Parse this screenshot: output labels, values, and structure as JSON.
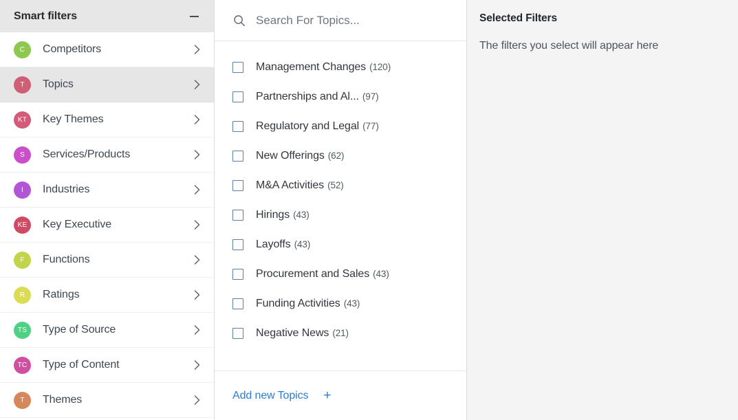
{
  "sidebar": {
    "title": "Smart filters",
    "collapse_icon": "minus-icon",
    "items": [
      {
        "label": "Competitors",
        "initials": "C",
        "color": "#8dc84f",
        "chevron": "chevron-right-icon",
        "active": false
      },
      {
        "label": "Topics",
        "initials": "T",
        "color": "#ce5f74",
        "chevron": "chevron-right-icon",
        "active": true
      },
      {
        "label": "Key Themes",
        "initials": "KT",
        "color": "#d35a78",
        "chevron": "chevron-right-icon",
        "active": false
      },
      {
        "label": "Services/Products",
        "initials": "S",
        "color": "#cb4fcb",
        "chevron": "chevron-right-icon",
        "active": false
      },
      {
        "label": "Industries",
        "initials": "I",
        "color": "#b255d6",
        "chevron": "chevron-right-icon",
        "active": false
      },
      {
        "label": "Key Executive",
        "initials": "KE",
        "color": "#cf4b63",
        "chevron": "chevron-right-icon",
        "active": false
      },
      {
        "label": "Functions",
        "initials": "F",
        "color": "#c2d44a",
        "chevron": "chevron-right-icon",
        "active": false
      },
      {
        "label": "Ratings",
        "initials": "R",
        "color": "#dbdb55",
        "chevron": "chevron-right-icon",
        "active": false
      },
      {
        "label": "Type of Source",
        "initials": "TS",
        "color": "#4ed183",
        "chevron": "chevron-right-icon",
        "active": false
      },
      {
        "label": "Type of Content",
        "initials": "TC",
        "color": "#d14fa0",
        "chevron": "chevron-right-icon",
        "active": false
      },
      {
        "label": "Themes",
        "initials": "T",
        "color": "#d6885c",
        "chevron": "chevron-right-icon",
        "active": false
      }
    ]
  },
  "middle": {
    "search": {
      "icon": "search-icon",
      "placeholder": "Search For Topics...",
      "value": ""
    },
    "topics": [
      {
        "label": "Management Changes",
        "count": "(120)",
        "checked": false
      },
      {
        "label": "Partnerships and Al...",
        "count": "(97)",
        "checked": false
      },
      {
        "label": "Regulatory and Legal",
        "count": "(77)",
        "checked": false
      },
      {
        "label": "New Offerings",
        "count": "(62)",
        "checked": false
      },
      {
        "label": "M&A Activities",
        "count": "(52)",
        "checked": false
      },
      {
        "label": "Hirings",
        "count": "(43)",
        "checked": false
      },
      {
        "label": "Layoffs",
        "count": "(43)",
        "checked": false
      },
      {
        "label": "Procurement and Sales",
        "count": "(43)",
        "checked": false
      },
      {
        "label": "Funding Activities",
        "count": "(43)",
        "checked": false
      },
      {
        "label": "Negative News",
        "count": "(21)",
        "checked": false
      }
    ],
    "add_new": {
      "label": "Add new Topics",
      "plus": "+"
    }
  },
  "right": {
    "title": "Selected Filters",
    "empty_message": "The filters you select will appear here"
  },
  "colors": {
    "accent_link": "#2b7cd3",
    "header_band": "#e7e7e7",
    "active_row": "#e6e6e6",
    "right_panel_bg": "#f4f4f4",
    "checkbox_border": "#5b7fa6"
  }
}
